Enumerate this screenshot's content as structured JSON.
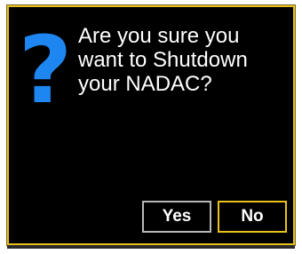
{
  "dialog": {
    "icon": "question-mark-icon",
    "icon_glyph": "?",
    "icon_color": "#1e86f0",
    "message": "Are you sure you\nwant to Shutdown\nyour NADAC?",
    "border_color": "#e8c11a",
    "buttons": {
      "yes_label": "Yes",
      "no_label": "No"
    }
  }
}
